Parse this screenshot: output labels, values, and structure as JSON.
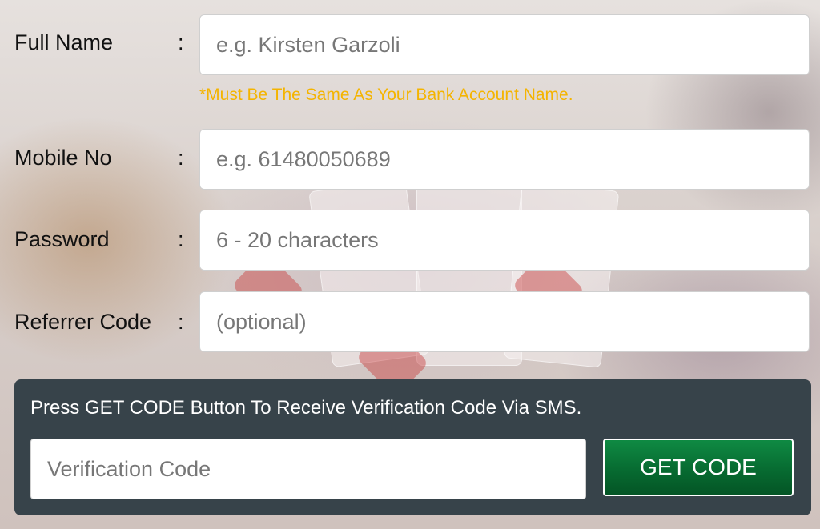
{
  "form": {
    "full_name": {
      "label": "Full Name",
      "colon": ":",
      "placeholder": "e.g. Kirsten Garzoli",
      "hint": "*Must Be The Same As Your Bank Account Name."
    },
    "mobile": {
      "label": "Mobile No",
      "colon": ":",
      "placeholder": "e.g. 61480050689"
    },
    "password": {
      "label": "Password",
      "colon": ":",
      "placeholder": "6 - 20 characters"
    },
    "referrer": {
      "label": "Referrer Code",
      "colon": ":",
      "placeholder": "(optional)"
    }
  },
  "verification": {
    "instruction": "Press GET CODE Button To Receive Verification Code Via SMS.",
    "placeholder": "Verification Code",
    "button_label": "GET CODE"
  },
  "colors": {
    "hint": "#f4b400",
    "panel": "#37434a",
    "button": "#0a7a3a"
  }
}
